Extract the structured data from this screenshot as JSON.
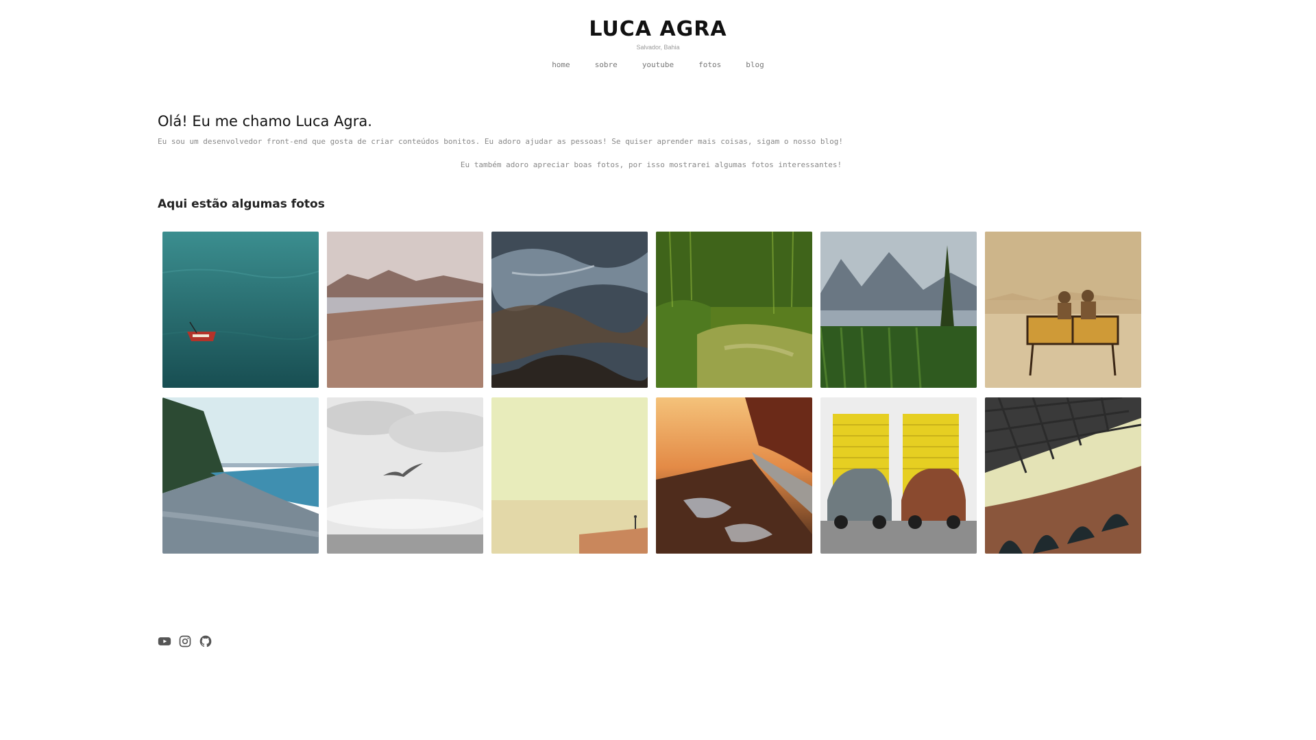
{
  "header": {
    "title": "LUCA AGRA",
    "subtitle": "Salvador, Bahia",
    "nav": [
      {
        "label": "home"
      },
      {
        "label": "sobre"
      },
      {
        "label": "youtube"
      },
      {
        "label": "fotos"
      },
      {
        "label": "blog"
      }
    ]
  },
  "intro": {
    "heading": "Olá! Eu me chamo Luca Agra.",
    "paragraph_1": "Eu sou um desenvolvedor front-end que gosta de criar conteúdos bonitos. Eu adoro ajudar as pessoas! Se quiser aprender mais coisas, sigam o nosso blog!",
    "paragraph_2": "Eu também adoro apreciar boas fotos, por isso mostrarei algumas fotos interessantes!"
  },
  "gallery": {
    "heading": "Aqui estão algumas fotos",
    "photos": [
      {
        "subject": "boat-on-teal-water",
        "colors": [
          "#2f7d7f",
          "#1d5557"
        ]
      },
      {
        "subject": "dry-grass-lake",
        "colors": [
          "#cbb6ad",
          "#8c6a5c"
        ]
      },
      {
        "subject": "abstract-water-reflection",
        "colors": [
          "#6a7f93",
          "#3a3128"
        ]
      },
      {
        "subject": "green-forest-moss",
        "colors": [
          "#6d8f2a",
          "#2f4d14"
        ]
      },
      {
        "subject": "mountain-lake-reeds",
        "colors": [
          "#9aa6b1",
          "#2f5a22"
        ]
      },
      {
        "subject": "couple-on-bench",
        "colors": [
          "#dcc9a6",
          "#b4894d"
        ]
      },
      {
        "subject": "pebble-beach-sea",
        "colors": [
          "#cfe3ea",
          "#5f7384"
        ]
      },
      {
        "subject": "bird-over-sea-bw",
        "colors": [
          "#e5e5e5",
          "#8f8f8f"
        ]
      },
      {
        "subject": "pale-yellow-horizon",
        "colors": [
          "#e9ecb8",
          "#d9c79a"
        ]
      },
      {
        "subject": "sunset-muddy-road",
        "colors": [
          "#d98e46",
          "#4d2a1b"
        ]
      },
      {
        "subject": "vintage-cars-yellow-doors",
        "colors": [
          "#e8d22f",
          "#7a7a7a"
        ]
      },
      {
        "subject": "bridge-arches",
        "colors": [
          "#e2e1b1",
          "#7a4d36"
        ]
      }
    ]
  },
  "footer": {
    "icons": [
      "youtube-icon",
      "instagram-icon",
      "github-icon"
    ],
    "icon_color": "#555555"
  }
}
